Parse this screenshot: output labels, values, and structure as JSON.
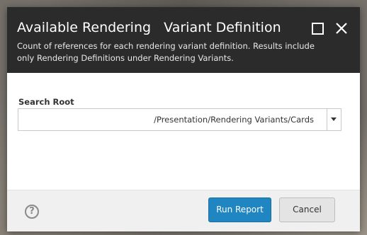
{
  "dialog": {
    "title": "Available Rendering   Variant Definition",
    "subtitle": "Count of references for each rendering variant definition. Results include only Rendering Definitions under Rendering Variants.",
    "maximize_icon": "maximize-icon",
    "close_icon": "close-icon"
  },
  "form": {
    "search_root_label": "Search Root",
    "search_root_value": "/Presentation/Rendering Variants/Cards"
  },
  "footer": {
    "help_icon": "help-icon",
    "help_glyph": "?",
    "run_report_label": "Run Report",
    "cancel_label": "Cancel"
  },
  "colors": {
    "header_bg": "#2b2b2b",
    "primary_button": "#1f86c1",
    "footer_bg": "#f0f0f0"
  }
}
